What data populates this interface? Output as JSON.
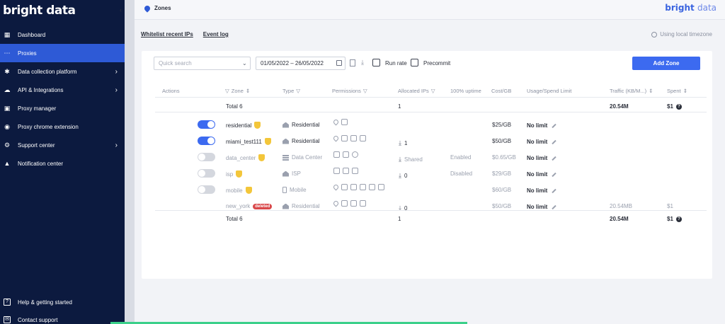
{
  "sidebar": {
    "logo": "bright data",
    "collapse_icon": "chevron-left-icon",
    "items": [
      {
        "label": "Dashboard",
        "icon": "dashboard-icon",
        "glyph": "▦",
        "active": false,
        "has_sub": false
      },
      {
        "label": "Proxies",
        "icon": "proxies-icon",
        "glyph": "⋯",
        "active": true,
        "has_sub": false
      },
      {
        "label": "Data collection platform",
        "icon": "bug-icon",
        "glyph": "✱",
        "active": false,
        "has_sub": true
      },
      {
        "label": "API & Integrations",
        "icon": "api-icon",
        "glyph": "☁",
        "active": false,
        "has_sub": true
      },
      {
        "label": "Proxy manager",
        "icon": "proxy-manager-icon",
        "glyph": "▣",
        "active": false,
        "has_sub": false
      },
      {
        "label": "Proxy chrome extension",
        "icon": "chrome-icon",
        "glyph": "◉",
        "active": false,
        "has_sub": false
      },
      {
        "label": "Support center",
        "icon": "gear-icon",
        "glyph": "⚙",
        "active": false,
        "has_sub": true
      },
      {
        "label": "Notification center",
        "icon": "bell-icon",
        "glyph": "▲",
        "active": false,
        "has_sub": false
      }
    ],
    "bottom": [
      {
        "label": "Help & getting started",
        "icon": "help-icon",
        "glyph": "?"
      },
      {
        "label": "Contact support",
        "icon": "contact-icon",
        "glyph": "✉"
      }
    ]
  },
  "topbar": {
    "title": "Zones",
    "brand_main": "bright",
    "brand_sub": "data"
  },
  "content": {
    "link_whitelist": "Whitelist recent IPs",
    "link_eventlog": "Event log",
    "timezone": "Using local timezone"
  },
  "filters": {
    "search_placeholder": "Quick search",
    "date_range": "01/05/2022 – 26/05/2022",
    "run_rate": "Run rate",
    "precommit": "Precommit",
    "add_zone": "Add Zone"
  },
  "table": {
    "headers": {
      "actions": "Actions",
      "zone": "Zone",
      "type": "Type",
      "permissions": "Permissions",
      "allocated": "Allocated IPs",
      "uptime": "100% uptime",
      "cost": "Cost/GB",
      "usage": "Usage/Spend Limit",
      "traffic": "Traffic (KB/M...)",
      "spent": "Spent"
    },
    "total_top": {
      "label": "Total 6",
      "allocated": "1",
      "traffic": "20.54M",
      "spent": "$1"
    },
    "rows": [
      {
        "enabled": true,
        "zone": "residential",
        "type": "Residential",
        "type_icon": "house",
        "allocated": "",
        "uptime": "",
        "cost": "$25/GB",
        "limit": "No limit",
        "traffic": "",
        "spent": "",
        "dim": false,
        "deleted": false,
        "shield": true
      },
      {
        "enabled": true,
        "zone": "miami_test111",
        "type": "Residential",
        "type_icon": "house",
        "allocated": "1",
        "uptime": "",
        "cost": "$50/GB",
        "limit": "No limit",
        "traffic": "",
        "spent": "",
        "dim": false,
        "deleted": false,
        "shield": true
      },
      {
        "enabled": false,
        "zone": "data_center",
        "type": "Data Center",
        "type_icon": "dc",
        "allocated": "Shared",
        "uptime": "Enabled",
        "cost": "$0.65/GB",
        "limit": "No limit",
        "traffic": "",
        "spent": "",
        "dim": true,
        "deleted": false,
        "shield": true
      },
      {
        "enabled": false,
        "zone": "isp",
        "type": "ISP",
        "type_icon": "house",
        "allocated": "0",
        "uptime": "Disabled",
        "cost": "$29/GB",
        "limit": "No limit",
        "traffic": "",
        "spent": "",
        "dim": true,
        "deleted": false,
        "shield": true
      },
      {
        "enabled": false,
        "zone": "mobile",
        "type": "Mobile",
        "type_icon": "mobile",
        "allocated": "",
        "uptime": "",
        "cost": "$60/GB",
        "limit": "No limit",
        "traffic": "",
        "spent": "",
        "dim": true,
        "deleted": false,
        "shield": true
      },
      {
        "enabled": null,
        "zone": "new_york",
        "type": "Residential",
        "type_icon": "house",
        "allocated": "0",
        "uptime": "",
        "cost": "$50/GB",
        "limit": "No limit",
        "traffic": "20.54MB",
        "spent": "$1",
        "dim": true,
        "deleted": true,
        "shield": false
      }
    ],
    "deleted_badge": "deleted",
    "total_bottom": {
      "label": "Total 6",
      "allocated": "1",
      "traffic": "20.54M",
      "spent": "$1"
    }
  }
}
